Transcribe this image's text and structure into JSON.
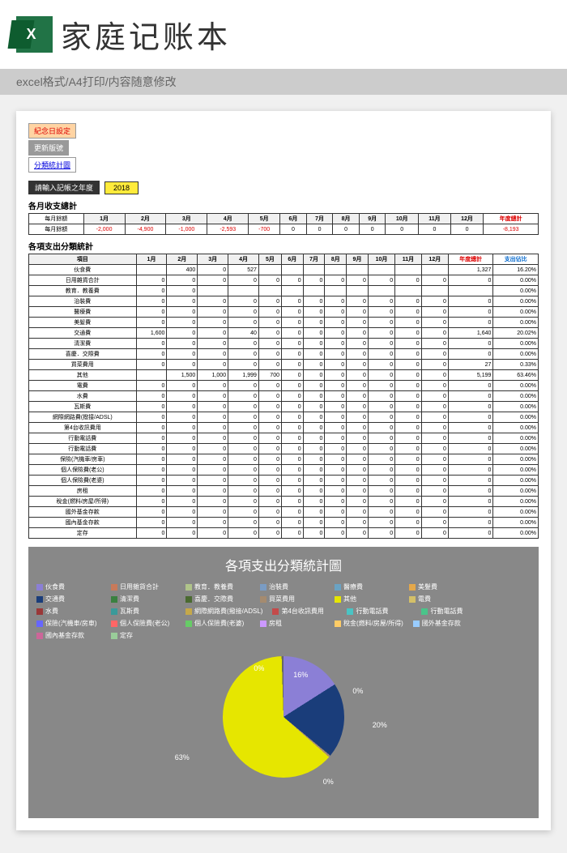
{
  "hero": {
    "logo": "X",
    "title": "家庭记账本",
    "sub": "excel格式/A4打印/内容随意修改"
  },
  "buttons": {
    "b1": "紀念日設定",
    "b2": "更新版號",
    "b3": "分類統計圖"
  },
  "year": {
    "label": "請輸入記帳之年度",
    "value": "2018"
  },
  "monthly": {
    "title": "各月收支總計",
    "headers": [
      "每月餘額",
      "1月",
      "2月",
      "3月",
      "4月",
      "5月",
      "6月",
      "7月",
      "8月",
      "9月",
      "10月",
      "11月",
      "12月",
      "年度總計"
    ],
    "values": [
      "",
      "-2,000",
      "-4,900",
      "-1,000",
      "-2,593",
      "-700",
      "0",
      "0",
      "0",
      "0",
      "0",
      "0",
      "0",
      "-8,193"
    ]
  },
  "cat": {
    "title": "各項支出分類統計",
    "headers": [
      "項目",
      "1月",
      "2月",
      "3月",
      "4月",
      "5月",
      "6月",
      "7月",
      "8月",
      "9月",
      "10月",
      "11月",
      "12月",
      "年度總計",
      "支出佔比"
    ],
    "rows": [
      {
        "name": "伙食費",
        "v": [
          "",
          "400",
          "0",
          "527",
          "",
          "",
          "",
          "",
          "",
          "",
          "",
          "",
          "1,327",
          "16.20%"
        ]
      },
      {
        "name": "日用雜貨合計",
        "v": [
          "0",
          "0",
          "0",
          "0",
          "0",
          "0",
          "0",
          "0",
          "0",
          "0",
          "0",
          "0",
          "0",
          "0.00%"
        ]
      },
      {
        "name": "教育．教養費",
        "v": [
          "0",
          "0",
          "",
          "",
          "",
          "",
          "",
          "",
          "",
          "",
          "",
          "",
          "",
          "0.00%"
        ]
      },
      {
        "name": "治裝費",
        "v": [
          "0",
          "0",
          "0",
          "0",
          "0",
          "0",
          "0",
          "0",
          "0",
          "0",
          "0",
          "0",
          "0",
          "0.00%"
        ]
      },
      {
        "name": "醫療費",
        "v": [
          "0",
          "0",
          "0",
          "0",
          "0",
          "0",
          "0",
          "0",
          "0",
          "0",
          "0",
          "0",
          "0",
          "0.00%"
        ]
      },
      {
        "name": "美髮費",
        "v": [
          "0",
          "0",
          "0",
          "0",
          "0",
          "0",
          "0",
          "0",
          "0",
          "0",
          "0",
          "0",
          "0",
          "0.00%"
        ]
      },
      {
        "name": "交通費",
        "v": [
          "1,600",
          "0",
          "0",
          "40",
          "0",
          "0",
          "0",
          "0",
          "0",
          "0",
          "0",
          "0",
          "1,640",
          "20.02%"
        ]
      },
      {
        "name": "清潔費",
        "v": [
          "0",
          "0",
          "0",
          "0",
          "0",
          "0",
          "0",
          "0",
          "0",
          "0",
          "0",
          "0",
          "0",
          "0.00%"
        ]
      },
      {
        "name": "喜慶．交際費",
        "v": [
          "0",
          "0",
          "0",
          "0",
          "0",
          "0",
          "0",
          "0",
          "0",
          "0",
          "0",
          "0",
          "0",
          "0.00%"
        ]
      },
      {
        "name": "買菜費用",
        "v": [
          "0",
          "0",
          "0",
          "0",
          "0",
          "0",
          "0",
          "0",
          "0",
          "0",
          "0",
          "0",
          "27",
          "0.33%"
        ]
      },
      {
        "name": "其他",
        "v": [
          "",
          "1,500",
          "1,000",
          "1,999",
          "700",
          "0",
          "0",
          "0",
          "0",
          "0",
          "0",
          "0",
          "5,199",
          "63.46%"
        ]
      },
      {
        "name": "電費",
        "v": [
          "0",
          "0",
          "0",
          "0",
          "0",
          "0",
          "0",
          "0",
          "0",
          "0",
          "0",
          "0",
          "0",
          "0.00%"
        ]
      },
      {
        "name": "水費",
        "v": [
          "0",
          "0",
          "0",
          "0",
          "0",
          "0",
          "0",
          "0",
          "0",
          "0",
          "0",
          "0",
          "0",
          "0.00%"
        ]
      },
      {
        "name": "瓦斯費",
        "v": [
          "0",
          "0",
          "0",
          "0",
          "0",
          "0",
          "0",
          "0",
          "0",
          "0",
          "0",
          "0",
          "0",
          "0.00%"
        ]
      },
      {
        "name": "網際網路費(撥接/ADSL)",
        "v": [
          "0",
          "0",
          "0",
          "0",
          "0",
          "0",
          "0",
          "0",
          "0",
          "0",
          "0",
          "0",
          "0",
          "0.00%"
        ]
      },
      {
        "name": "第4台收訊費用",
        "v": [
          "0",
          "0",
          "0",
          "0",
          "0",
          "0",
          "0",
          "0",
          "0",
          "0",
          "0",
          "0",
          "0",
          "0.00%"
        ]
      },
      {
        "name": "行動電話費",
        "v": [
          "0",
          "0",
          "0",
          "0",
          "0",
          "0",
          "0",
          "0",
          "0",
          "0",
          "0",
          "0",
          "0",
          "0.00%"
        ]
      },
      {
        "name": "行動電話費",
        "v": [
          "0",
          "0",
          "0",
          "0",
          "0",
          "0",
          "0",
          "0",
          "0",
          "0",
          "0",
          "0",
          "0",
          "0.00%"
        ]
      },
      {
        "name": "保險(汽機車/房車)",
        "v": [
          "0",
          "0",
          "0",
          "0",
          "0",
          "0",
          "0",
          "0",
          "0",
          "0",
          "0",
          "0",
          "0",
          "0.00%"
        ]
      },
      {
        "name": "個人保險費(老公)",
        "v": [
          "0",
          "0",
          "0",
          "0",
          "0",
          "0",
          "0",
          "0",
          "0",
          "0",
          "0",
          "0",
          "0",
          "0.00%"
        ]
      },
      {
        "name": "個人保險費(老婆)",
        "v": [
          "0",
          "0",
          "0",
          "0",
          "0",
          "0",
          "0",
          "0",
          "0",
          "0",
          "0",
          "0",
          "0",
          "0.00%"
        ]
      },
      {
        "name": "房租",
        "v": [
          "0",
          "0",
          "0",
          "0",
          "0",
          "0",
          "0",
          "0",
          "0",
          "0",
          "0",
          "0",
          "0",
          "0.00%"
        ]
      },
      {
        "name": "稅金(燃料/房屋/所得)",
        "v": [
          "0",
          "0",
          "0",
          "0",
          "0",
          "0",
          "0",
          "0",
          "0",
          "0",
          "0",
          "0",
          "0",
          "0.00%"
        ]
      },
      {
        "name": "國外基金存款",
        "v": [
          "0",
          "0",
          "0",
          "0",
          "0",
          "0",
          "0",
          "0",
          "0",
          "0",
          "0",
          "0",
          "0",
          "0.00%"
        ]
      },
      {
        "name": "國內基金存款",
        "v": [
          "0",
          "0",
          "0",
          "0",
          "0",
          "0",
          "0",
          "0",
          "0",
          "0",
          "0",
          "0",
          "0",
          "0.00%"
        ]
      },
      {
        "name": "定存",
        "v": [
          "0",
          "0",
          "0",
          "0",
          "0",
          "0",
          "0",
          "0",
          "0",
          "0",
          "0",
          "0",
          "0",
          "0.00%"
        ]
      }
    ]
  },
  "chart_data": {
    "type": "pie",
    "title": "各項支出分類統計圖",
    "series": [
      {
        "name": "伙食費",
        "value": 16,
        "color": "#8b7fd6"
      },
      {
        "name": "交通費",
        "value": 20,
        "color": "#1a3d7a"
      },
      {
        "name": "買菜費用",
        "value": 0.33,
        "color": "#a58b6f"
      },
      {
        "name": "其他",
        "value": 63,
        "color": "#e6e600"
      }
    ],
    "legend": [
      {
        "n": "伙食費",
        "c": "#8b7fd6"
      },
      {
        "n": "日用雜貨合計",
        "c": "#c87a5a"
      },
      {
        "n": "教育．教養費",
        "c": "#b0c48a"
      },
      {
        "n": "治裝費",
        "c": "#7a9cc4"
      },
      {
        "n": "醫療費",
        "c": "#6aa3c4"
      },
      {
        "n": "美髮費",
        "c": "#e4a84a"
      },
      {
        "n": "交通費",
        "c": "#1a3d7a"
      },
      {
        "n": "清潔費",
        "c": "#3a8040"
      },
      {
        "n": "喜慶．交際費",
        "c": "#4a6a30"
      },
      {
        "n": "買菜費用",
        "c": "#a58b6f"
      },
      {
        "n": "其他",
        "c": "#e6e600"
      },
      {
        "n": "電費",
        "c": "#d4c068"
      },
      {
        "n": "水費",
        "c": "#9a3838"
      },
      {
        "n": "瓦斯費",
        "c": "#3a9a9a"
      },
      {
        "n": "網際網路費(撥接/ADSL)",
        "c": "#c5a84a"
      },
      {
        "n": "第4台收訊費用",
        "c": "#c44a4a"
      },
      {
        "n": "行動電話費",
        "c": "#4ac4c4"
      },
      {
        "n": "行動電話費",
        "c": "#4ac48a"
      },
      {
        "n": "保險(汽機車/房車)",
        "c": "#6666ff"
      },
      {
        "n": "個人保險費(老公)",
        "c": "#ff6666"
      },
      {
        "n": "個人保險費(老婆)",
        "c": "#66cc66"
      },
      {
        "n": "房租",
        "c": "#cc99ff"
      },
      {
        "n": "稅金(燃料/房屋/所得)",
        "c": "#ffcc66"
      },
      {
        "n": "國外基金存款",
        "c": "#99ccff"
      },
      {
        "n": "國內基金存款",
        "c": "#cc6699"
      },
      {
        "n": "定存",
        "c": "#99cc99"
      }
    ],
    "labels": {
      "l1": "0%",
      "l2": "16%",
      "l3": "0%",
      "l4": "20%",
      "l5": "0%",
      "l6": "63%"
    }
  }
}
